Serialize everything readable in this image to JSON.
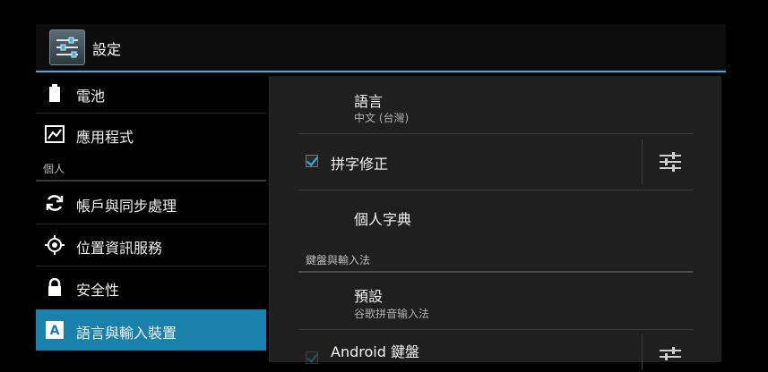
{
  "actionbar": {
    "title": "設定",
    "icon": "settings-sliders-icon"
  },
  "sidebar": {
    "items": [
      {
        "label": "電池",
        "icon": "battery-icon"
      },
      {
        "label": "應用程式",
        "icon": "apps-icon"
      },
      {
        "label": "帳戶與同步處理",
        "icon": "sync-icon"
      },
      {
        "label": "位置資訊服務",
        "icon": "location-icon"
      },
      {
        "label": "安全性",
        "icon": "lock-icon"
      },
      {
        "label": "語言與輸入裝置",
        "icon": "language-icon",
        "selected": true
      }
    ],
    "section_personal": "個人"
  },
  "panel": {
    "language": {
      "title": "語言",
      "summary": "中文 (台灣)"
    },
    "spell_checker": {
      "title": "拼字修正",
      "checked": true,
      "settings_icon": "tune-icon"
    },
    "personal_dictionary": {
      "title": "個人字典"
    },
    "category_keyboard": "鍵盤與輸入法",
    "default_ime": {
      "title": "預設",
      "summary": "谷歌拼音输入法"
    },
    "android_keyboard": {
      "title": "Android 鍵盤",
      "checked": true,
      "settings_icon": "tune-icon"
    }
  },
  "colors": {
    "accent": "#33b5e5",
    "selected_bg": "#1a81ac",
    "panel_bg": "#1f1f1f"
  }
}
